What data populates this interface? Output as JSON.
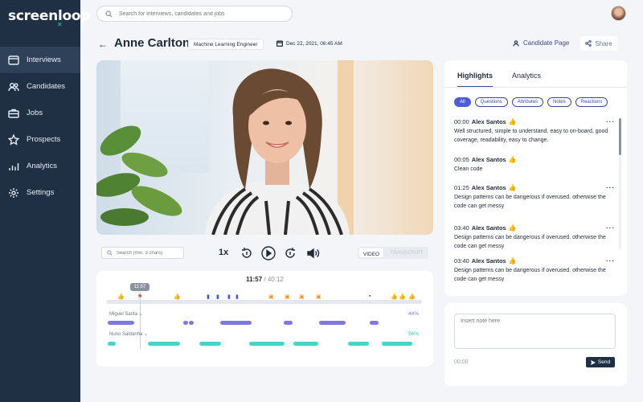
{
  "app": {
    "logo": "screenloop"
  },
  "sidebar": {
    "items": [
      {
        "label": "Interviews",
        "icon": "interviews-icon",
        "active": true
      },
      {
        "label": "Candidates",
        "icon": "candidates-icon",
        "active": false
      },
      {
        "label": "Jobs",
        "icon": "jobs-icon",
        "active": false
      },
      {
        "label": "Prospects",
        "icon": "star-icon",
        "active": false
      },
      {
        "label": "Analytics",
        "icon": "analytics-icon",
        "active": false
      },
      {
        "label": "Settings",
        "icon": "gear-icon",
        "active": false
      }
    ]
  },
  "search": {
    "placeholder": "Search for interviews, candidates and jobs"
  },
  "header": {
    "back_icon": "back-arrow-icon",
    "name": "Anne Carlton",
    "role": "Machine Learning Engineer",
    "date": "Dec 22, 2021, 06:45 AM",
    "candidate_page": "Candidate Page",
    "share": "Share"
  },
  "player": {
    "search_placeholder": "Search (min. 3 chars)",
    "speed": "1x",
    "toggle_video": "VIDEO",
    "toggle_transcript": "TRANSCRIPT"
  },
  "timeline": {
    "current": "11:57",
    "separator": " / ",
    "total": "40:12",
    "playhead_label": "11:57",
    "speakers": [
      {
        "name": "Miguel Sarita",
        "percent": "44%",
        "color": "#7f78e0"
      },
      {
        "name": "Nuno Saldanha",
        "percent": "56%",
        "color": "#45d6c6"
      }
    ]
  },
  "panel": {
    "tabs": [
      {
        "label": "Highlights",
        "active": true
      },
      {
        "label": "Analytics",
        "active": false
      }
    ],
    "filters": [
      {
        "label": "All",
        "active": true
      },
      {
        "label": "Questions",
        "active": false
      },
      {
        "label": "Attributes",
        "active": false
      },
      {
        "label": "Notes",
        "active": false
      },
      {
        "label": "Reactions",
        "active": false
      }
    ],
    "highlights": [
      {
        "time": "00:00",
        "author": "Alex Santos",
        "text": "Well structured, simple to understand, easy to on-board, good coverage, readability, easy to change."
      },
      {
        "time": "00:05",
        "author": "Alex Santos",
        "text": "Clean code"
      },
      {
        "time": "01:25",
        "author": "Alex Santos",
        "text": "Design patterns can be dangerous if overused. otherwise the code can get messy"
      },
      {
        "time": "03:40",
        "author": "Alex Santos",
        "text": "Design patterns can be dangerous if overused. otherwise the code can get messy"
      },
      {
        "time": "03:40",
        "author": "Alex Santos",
        "text": "Design patterns can be dangerous if overused. otherwise the code can get messy"
      }
    ]
  },
  "note": {
    "placeholder": "Insert note here",
    "time": "00:00",
    "send": "Send"
  }
}
